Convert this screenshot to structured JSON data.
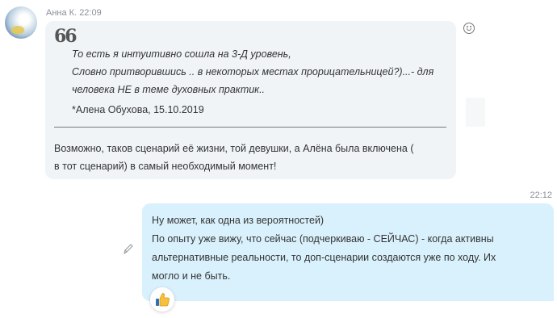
{
  "incoming": {
    "sender": "Анна К.",
    "time": "22:09",
    "quote_mark": "66",
    "quote_lines": [
      "То есть я интуитивно сошла на 3-Д уровень,",
      "Словно притворившись .. в некоторых местах прорицательницей?)...- для",
      "человека НЕ в теме духовных практик.."
    ],
    "quote_author": "*Алена Обухова, 15.10.2019",
    "message_lines": [
      "Возможно, таков сценарий её жизни, той девушки, а Алёна была включена (",
      "в тот сценарий) в самый необходимый момент!"
    ]
  },
  "outgoing": {
    "time": "22:12",
    "lines": [
      "Ну может, как одна из вероятностей)",
      "По опыту уже вижу, что сейчас (подчеркиваю - СЕЙЧАС) - когда активны",
      "альтернативные реальности, то доп-сценарии создаются уже по ходу. Их",
      "могло и не быть."
    ],
    "reaction_icon": "thumbs-up-icon"
  },
  "icons": {
    "emoji": "smiley-icon",
    "edit": "pencil-icon"
  },
  "colors": {
    "incoming_bubble": "#f1f4f7",
    "outgoing_bubble": "#d9f1fc",
    "meta_text": "#8a8f98"
  }
}
